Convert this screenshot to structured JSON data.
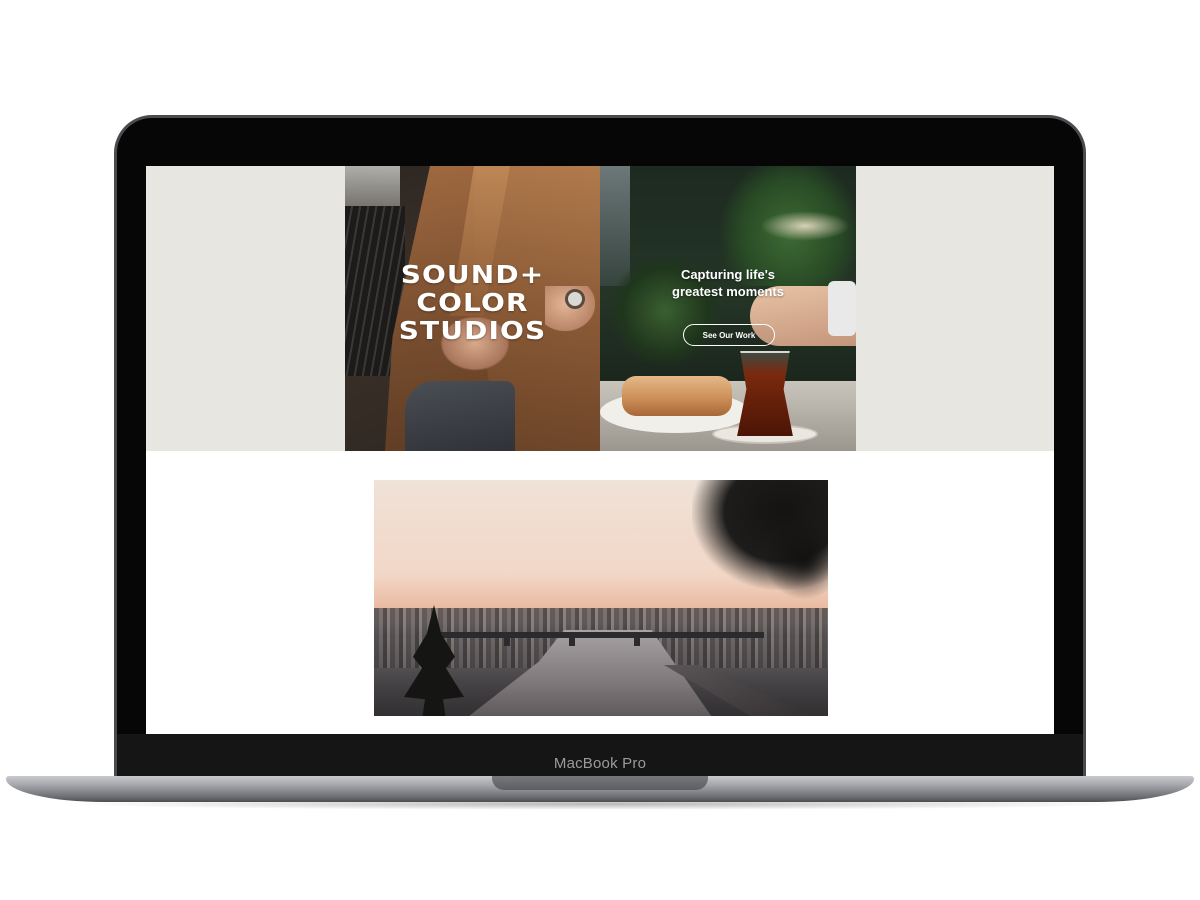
{
  "device": {
    "model_label": "MacBook Pro"
  },
  "website": {
    "hero": {
      "logo_text_lines": [
        "SOUND+",
        "COLOR",
        "STUDIOS"
      ],
      "tagline_lines": [
        "Capturing life's",
        "greatest moments"
      ],
      "cta_label": "See Our Work",
      "left_image": "man-in-trench-coat-photo",
      "right_image": "tea-and-pastry-photo"
    },
    "gallery": {
      "image": "city-river-at-dusk-photo"
    }
  },
  "colors": {
    "hero_background": "#e7e6e1",
    "page_background": "#ffffff",
    "bezel": "#060606",
    "chassis": "#a5a6ab"
  }
}
